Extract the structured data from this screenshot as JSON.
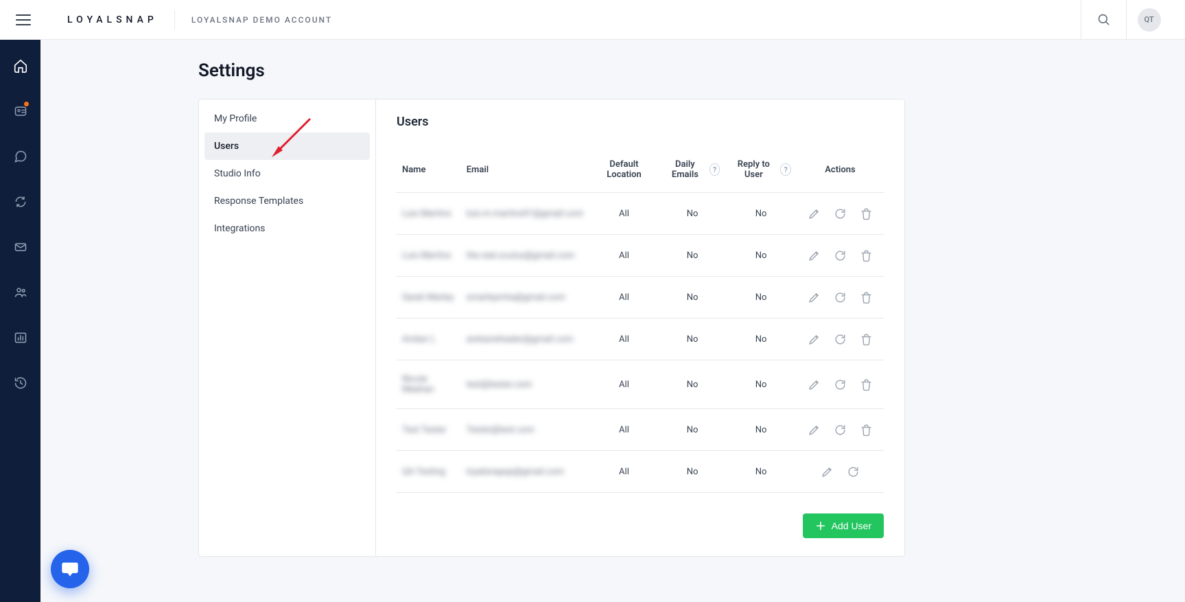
{
  "brand": "LOYALSNAP",
  "account_name": "LOYALSNAP DEMO ACCOUNT",
  "avatar_initials": "QT",
  "page_title": "Settings",
  "settings_menu": [
    {
      "label": "My Profile"
    },
    {
      "label": "Users",
      "active": true
    },
    {
      "label": "Studio Info"
    },
    {
      "label": "Response Templates"
    },
    {
      "label": "Integrations"
    }
  ],
  "panel_title": "Users",
  "table": {
    "headers": {
      "name": "Name",
      "email": "Email",
      "default_location": "Default Location",
      "daily_emails": "Daily Emails",
      "reply_to_user": "Reply to User",
      "actions": "Actions"
    },
    "rows": [
      {
        "name": "Luis Martins",
        "email": "luis.m.martins91@gmail.com",
        "default_location": "All",
        "daily_emails": "No",
        "reply_to_user": "No",
        "deletable": true
      },
      {
        "name": "Luis Martins",
        "email": "the.real.oculus@gmail.com",
        "default_location": "All",
        "daily_emails": "No",
        "reply_to_user": "No",
        "deletable": true
      },
      {
        "name": "Sarah Marley",
        "email": "smarleymha@gmail.com",
        "default_location": "All",
        "daily_emails": "No",
        "reply_to_user": "No",
        "deletable": true
      },
      {
        "name": "Amber L",
        "email": "aretasrehealer@gmail.com",
        "default_location": "All",
        "daily_emails": "No",
        "reply_to_user": "No",
        "deletable": true
      },
      {
        "name": "Nicole Meehan",
        "email": "test@tester.com",
        "default_location": "All",
        "daily_emails": "No",
        "reply_to_user": "No",
        "deletable": true
      },
      {
        "name": "Test Tester",
        "email": "Tester@test.com",
        "default_location": "All",
        "daily_emails": "No",
        "reply_to_user": "No",
        "deletable": true
      },
      {
        "name": "QA Testing",
        "email": "loyalsnapqa@gmail.com",
        "default_location": "All",
        "daily_emails": "No",
        "reply_to_user": "No",
        "deletable": false
      }
    ]
  },
  "add_user_label": "Add User"
}
